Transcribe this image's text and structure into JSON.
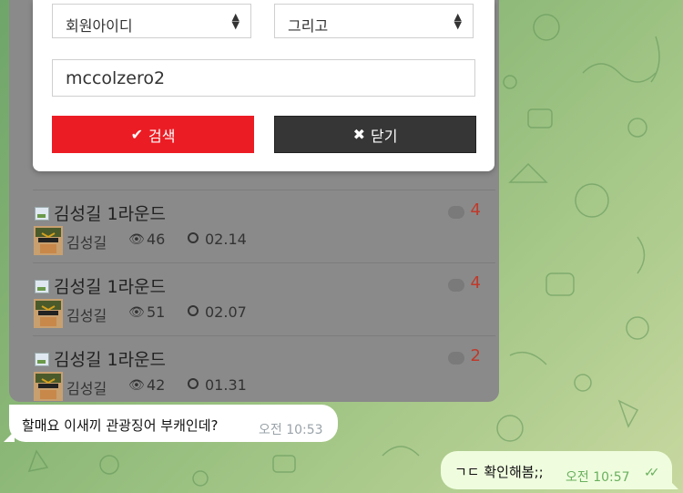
{
  "search": {
    "field_select": "회원아이디",
    "operator_select": "그리고",
    "query_value": "mccolzero2",
    "search_button": "검색",
    "close_button": "닫기"
  },
  "posts": [
    {
      "title": "김성길 1라운드",
      "author": "김성길",
      "views": "46",
      "date": "02.14",
      "comments": "4"
    },
    {
      "title": "김성길 1라운드",
      "author": "김성길",
      "views": "51",
      "date": "02.07",
      "comments": "4"
    },
    {
      "title": "김성길 1라운드",
      "author": "김성길",
      "views": "42",
      "date": "01.31",
      "comments": "2"
    }
  ],
  "messages": {
    "incoming": {
      "text": "할매요 이새끼 관광징어 부캐인데?",
      "time": "오전 10:53"
    },
    "outgoing": {
      "text": "ㄱㄷ 확인해봄;;",
      "time": "오전 10:57"
    }
  },
  "colors": {
    "search_button": "#ec1c24",
    "close_button": "#363636",
    "comment_count": "#c0392b",
    "outgoing_bubble": "#effdde"
  },
  "icons": [
    "check-icon",
    "x-icon",
    "comment-icon",
    "eye-icon",
    "clock-icon",
    "image-icon",
    "double-check-icon",
    "sort-arrows-icon"
  ]
}
